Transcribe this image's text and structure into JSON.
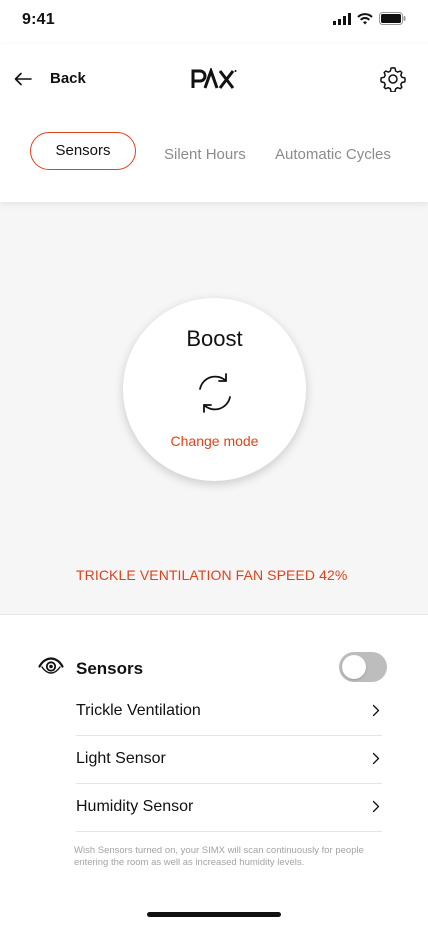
{
  "status": {
    "time": "9:41"
  },
  "header": {
    "back_label": "Back",
    "logo_text": "PAX"
  },
  "tabs": [
    {
      "label": "Sensors",
      "active": true
    },
    {
      "label": "Silent Hours",
      "active": false
    },
    {
      "label": "Automatic Cycles",
      "active": false
    }
  ],
  "mode": {
    "title": "Boost",
    "change_label": "Change mode"
  },
  "fan_speed_text": "TRICKLE VENTILATION FAN SPEED 42%",
  "sensors": {
    "label": "Sensors",
    "enabled": false,
    "items": [
      {
        "label": "Trickle Ventilation"
      },
      {
        "label": "Light Sensor"
      },
      {
        "label": "Humidity Sensor"
      }
    ],
    "note": "Wish Sensors turned on, your SIMX will scan continuously for people entering the room as well as increased humidity levels."
  },
  "colors": {
    "accent": "#e0431b",
    "toggle_off": "#bdbdbd"
  },
  "icons": [
    "back-arrow-icon",
    "gear-icon",
    "cycle-icon",
    "eye-icon",
    "chevron-right-icon",
    "signal-icon",
    "wifi-icon",
    "battery-icon"
  ]
}
